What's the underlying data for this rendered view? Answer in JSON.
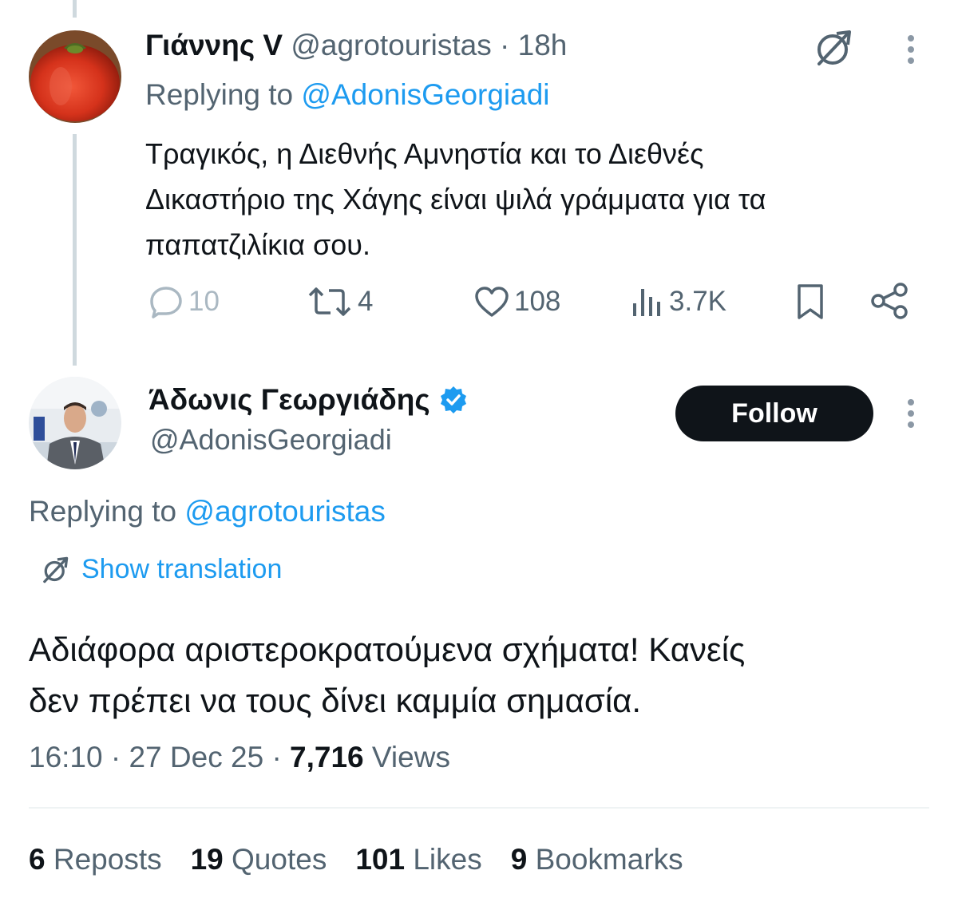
{
  "reply_tweet": {
    "display_name": "Γιάννης V",
    "handle": "@agrotouristas",
    "time": "· 18h",
    "replying_prefix": "Replying to",
    "replying_handle": "@AdonisGeorgiadi",
    "text_lines": [
      "Τραγικός, η Διεθνής Αμνηστία και το Διεθνές",
      "Δικαστήριο της Χάγης είναι ψιλά γράμματα για τα",
      "παπατζιλίκια σου."
    ],
    "replies": "10",
    "reposts": "4",
    "likes": "108",
    "views": "3.7K",
    "icons": [
      "translate-icon",
      "more-icon",
      "reply-icon",
      "repost-icon",
      "like-icon",
      "views-icon",
      "bookmark-icon",
      "share-icon"
    ]
  },
  "main_tweet": {
    "display_name": "Άδωνις Γεωργιάδης",
    "handle": "@AdonisGeorgiadi",
    "follow_label": "Follow",
    "replying_prefix": "Replying to",
    "replying_handle": "@agrotouristas",
    "show_translation": "Show translation",
    "text_lines": [
      "Αδιάφορα αριστεροκρατούμενα σχήματα! Κανείς",
      "δεν πρέπει να τους δίνει καμμία σημασία."
    ],
    "time": "16:10",
    "date": "27 Dec 25",
    "views_count": "7,716",
    "views_label": "Views"
  },
  "stats": [
    {
      "count": "6",
      "label": "Reposts"
    },
    {
      "count": "19",
      "label": "Quotes"
    },
    {
      "count": "101",
      "label": "Likes"
    },
    {
      "count": "9",
      "label": "Bookmarks"
    }
  ],
  "colors": {
    "accent": "#1d9bf0",
    "text": "#0f1419",
    "secondary": "#536471",
    "verified": "#1d9bf0"
  }
}
